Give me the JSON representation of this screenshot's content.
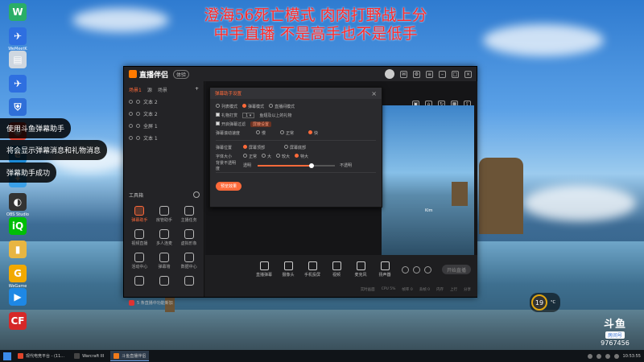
{
  "overlay": {
    "line1": "澄海56死亡模式 肉肉打野战上分",
    "line2": "中手直播 不是高手也不是低手"
  },
  "desktop_icons": [
    {
      "icon": "wechat-icon",
      "label": "",
      "color": "#2aae67",
      "glyph": "W"
    },
    {
      "icon": "app-shortcut-icon",
      "label": "WeMeetK",
      "color": "#2e6fe0",
      "glyph": "✈"
    },
    {
      "icon": "document-icon",
      "label": "",
      "color": "#cfd7e0",
      "glyph": "▤"
    },
    {
      "icon": "shortcut-icon",
      "label": "",
      "color": "#2e6fe0",
      "glyph": "✈"
    },
    {
      "icon": "shield-icon",
      "label": "",
      "color": "#2f6fd8",
      "glyph": "⛨"
    },
    {
      "icon": "chrome-icon",
      "label": "",
      "color": "#e34133",
      "glyph": "◉"
    },
    {
      "icon": "edge-icon",
      "label": "",
      "color": "#1b8ad6",
      "glyph": "e"
    },
    {
      "icon": "feather-icon",
      "label": "",
      "color": "#3aa0e8",
      "glyph": "✦"
    },
    {
      "icon": "app-icon",
      "label": "OBS Studio",
      "color": "#333",
      "glyph": "◐"
    },
    {
      "icon": "iqiyi-icon",
      "label": "",
      "color": "#00be06",
      "glyph": "iQ"
    },
    {
      "icon": "folder-icon",
      "label": "",
      "color": "#e8b542",
      "glyph": "▮"
    },
    {
      "icon": "wegame-icon",
      "label": "WeGame",
      "color": "#f2a900",
      "glyph": "G"
    },
    {
      "icon": "play-icon",
      "label": "",
      "color": "#1e88e5",
      "glyph": "▶"
    },
    {
      "icon": "crossfire-icon",
      "label": "",
      "color": "#d62828",
      "glyph": "CF"
    }
  ],
  "toasts": [
    "使用斗鱼弹幕助手",
    "将会显示弹幕消息和礼物消息",
    "弹幕助手成功"
  ],
  "app": {
    "brand": "直播伴侣",
    "badge": "体验",
    "sidebar_tabs": [
      "场景1",
      "源",
      "场景"
    ],
    "layers": [
      "文本 2",
      "文本 2",
      "全屏 1",
      "文本 1"
    ],
    "tools_title": "工具箱",
    "tools": [
      {
        "label": "弹幕助手",
        "on": true
      },
      {
        "label": "房管助手",
        "on": false
      },
      {
        "label": "主播任务",
        "on": false
      },
      {
        "label": "视频直播",
        "on": false
      },
      {
        "label": "多人连麦",
        "on": false
      },
      {
        "label": "虚拟形象",
        "on": false
      },
      {
        "label": "活动中心",
        "on": false
      },
      {
        "label": "弹幕墙",
        "on": false
      },
      {
        "label": "数据中心",
        "on": false
      },
      {
        "label": "",
        "on": false
      },
      {
        "label": "",
        "on": false
      },
      {
        "label": "",
        "on": false
      }
    ],
    "notice": "5 条直播中功能新加",
    "preview_label": "Kim",
    "panel": {
      "title": "弹幕助手设置",
      "modes": [
        "列表模式",
        "弹幕模式",
        "直播间模式"
      ],
      "opt_gift": "礼物打赏",
      "gift_value": "1",
      "gift_hint": "鱼翅及以上的礼物",
      "opt_fans": "开启弹幕过滤",
      "fans_btn": "屏蔽设置",
      "speed_label": "弹幕滚动速度",
      "speeds": [
        "慢",
        "正常",
        "快"
      ],
      "pos_label": "弹幕位置",
      "positions": [
        "屏幕顶部",
        "屏幕底部"
      ],
      "size_label": "字体大小",
      "sizes": [
        "正常",
        "大",
        "较大",
        "特大"
      ],
      "opacity_label": "背景不透明度",
      "opacity_left": "透明",
      "opacity_right": "不透明",
      "opacity_value": 0.7,
      "apply": "预览效果"
    },
    "bottom_tools": [
      "直播弹幕",
      "摄像头",
      "手机投屏",
      "视频",
      "麦克风",
      "扬声器"
    ],
    "start": "开始直播",
    "status": [
      "实时画面",
      "CPU 5%",
      "帧率 0",
      "丢帧 0",
      "内存",
      "上行",
      "分享"
    ]
  },
  "weather": {
    "temp": "19",
    "line1": "°C",
    "line2": ""
  },
  "douyu": {
    "logo": "斗鱼",
    "room_label": "房间号",
    "room_number": "9767456"
  },
  "taskbar": {
    "items": [
      {
        "label": "现代电竞平台 - (11...",
        "color": "#e0452b",
        "active": false
      },
      {
        "label": "Warcraft III",
        "color": "#444",
        "active": false
      },
      {
        "label": "斗鱼直播伴侣",
        "color": "#f27a1a",
        "active": true
      }
    ],
    "clock": "10:53:55"
  },
  "colors": {
    "accent": "#ff6a3a",
    "overlay_red": "#ff2a2a"
  }
}
